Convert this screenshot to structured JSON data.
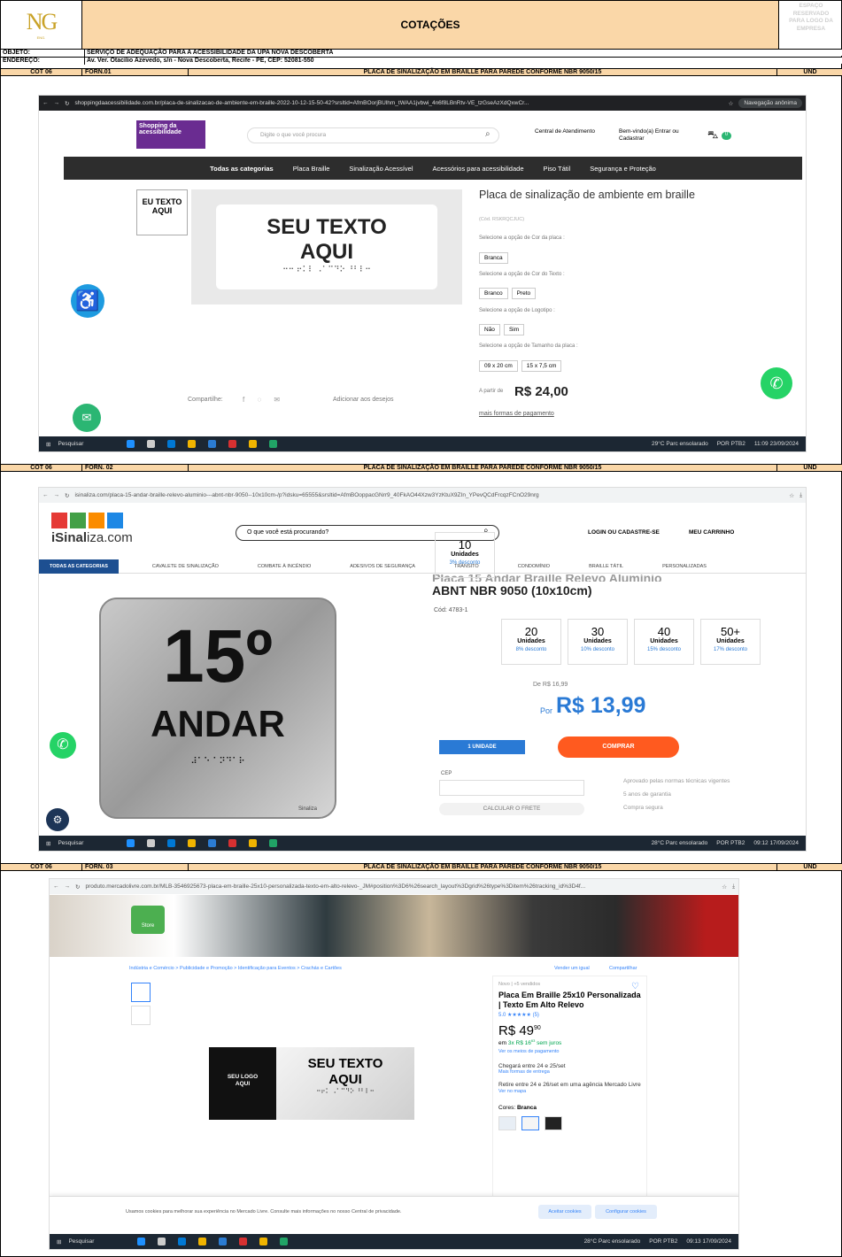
{
  "header": {
    "logo_text": "NG",
    "logo_sub": "ENG.",
    "title": "COTAÇÕES",
    "reserved": [
      "ESPAÇO",
      "RESERVADO",
      "PARA LOGO DA",
      "EMPRESA"
    ]
  },
  "info": {
    "objeto_label": "OBJETO:",
    "objeto": "SERVIÇO DE ADEQUAÇÃO PARA A ACESSIBILIDADE DA UPA NOVA DESCOBERTA",
    "endereco_label": "ENDEREÇO:",
    "endereco": "Av. Ver. Otacílio Azevedo, s/n - Nova Descoberta, Recife - PE, CEP: 52081-550"
  },
  "offers": [
    {
      "cot": "COT 06",
      "forn": "FORN.01",
      "desc": "PLACA DE SINALIZAÇÃO EM BRAILLE PARA PAREDE CONFORME NBR 9050/15",
      "und": "UND"
    },
    {
      "cot": "COT 06",
      "forn": "FORN. 02",
      "desc": "PLACA DE SINALIZAÇÃO EM BRAILLE PARA PAREDE CONFORME NBR 9050/15",
      "und": "UND"
    },
    {
      "cot": "COT 06",
      "forn": "FORN. 03",
      "desc": "PLACA DE SINALIZAÇÃO EM BRAILLE PARA PAREDE CONFORME NBR 9050/15",
      "und": "UND"
    }
  ],
  "shot1": {
    "url": "shoppingdaacessibilidade.com.br/placa-de-sinalizacao-de-ambiente-em-braille-2022-10-12-15-50-42?srsltid=AfmBOorjBUlhm_tWAA1jvbwi_4n6f8LBnRtv-VE_tzGseAzXdQxwCr...",
    "incognito": "Navegação anônima",
    "brand": "Shopping da acessibilidade",
    "search_placeholder": "Digite o que você procura",
    "central": "Central de Atendimento",
    "welcome": "Bem-vindo(a) Entrar ou Cadastrar",
    "cart_count": "0",
    "nav": [
      "Todas as categorias",
      "Placa Braille",
      "Sinalização Acessível",
      "Acessórios para acessibilidade",
      "Piso Tátil",
      "Segurança e Proteção"
    ],
    "thumb_text": "EU TEXTO AQUI",
    "image_text": [
      "SEU TEXTO",
      "AQUI"
    ],
    "braille": "⠒⠒ ⠖⠅⠇ ⠠⠁⠉⠙⠕ ⠘⠃⠇⠒",
    "title": "Placa de sinalização de ambiente em braille",
    "code": "(Cód. RSKRQCJUC)",
    "opt_cor_label": "Selecione a opção de Cor da placa :",
    "opt_cor": [
      "Branca"
    ],
    "opt_texto_label": "Selecione a opção de Cor do Texto :",
    "opt_texto": [
      "Branco",
      "Preto"
    ],
    "opt_logo_label": "Selecione a opção de Logotipo :",
    "opt_logo": [
      "Não",
      "Sim"
    ],
    "opt_tam_label": "Selecione a opção de Tamanho da placa :",
    "opt_tam": [
      "09 x 20 cm",
      "15 x 7,5 cm"
    ],
    "price_prefix": "A partir de",
    "price": "R$ 24,00",
    "payment": "mais formas de pagamento",
    "share": "Compartilhe:",
    "wishlist": "Adicionar aos desejos",
    "tb_search": "Pesquisar",
    "weather": "29°C Parc ensolarado",
    "lang": "POR PTB2",
    "clock": "11:09 23/09/2024"
  },
  "shot2": {
    "url": "isinaliza.com/placa-15-andar-braille-relevo-aluminio---abnt-nbr-9050--10x10cm-/p?idsku=65555&srsltid=AfmBOoppacGNrr9_40FkAO44Xzw3YzKtuX9ZIn_YPevQCdFrcqzFCnO29nrg",
    "brand_a": "iSinal",
    "brand_b": "iza.com",
    "search_placeholder": "O que você está procurando?",
    "login": "LOGIN OU CADASTRE-SE",
    "cart": "MEU CARRINHO",
    "nav": [
      "TODAS AS CATEGORIAS",
      "CAVALETE DE SINALIZAÇÃO",
      "COMBATE À INCÊNDIO",
      "ADESIVOS DE SEGURANÇA",
      "TRÂNSITO",
      "CONDOMÍNIO",
      "BRAILLE TÁTIL",
      "PERSONALIZADAS"
    ],
    "title_partial": "Placa 15 Andar Braille Relevo Alumínio",
    "title": "ABNT NBR 9050 (10x10cm)",
    "code": "Cód: 4783-1",
    "sign_num": "15º",
    "sign_word": "ANDAR",
    "sign_brand": "Sinaliza",
    "tiers": [
      {
        "q": "10",
        "u": "Unidades",
        "d": "3% desconto"
      },
      {
        "q": "20",
        "u": "Unidades",
        "d": "8% desconto"
      },
      {
        "q": "30",
        "u": "Unidades",
        "d": "10% desconto"
      },
      {
        "q": "40",
        "u": "Unidades",
        "d": "15% desconto"
      },
      {
        "q": "50+",
        "u": "Unidades",
        "d": "17% desconto"
      }
    ],
    "old_price": "De R$ 16,99",
    "price_prefix": "Por",
    "price": "R$ 13,99",
    "qty": "1 UNIDADE",
    "buy": "COMPRAR",
    "cep_label": "CEP",
    "frete": "CALCULAR O FRETE",
    "badges": [
      "Aprovado pelas normas técnicas vigentes",
      "5 anos de garantia",
      "Compra segura"
    ],
    "tb_search": "Pesquisar",
    "weather": "28°C Parc ensolarado",
    "lang": "POR PTB2",
    "clock": "09:12 17/09/2024"
  },
  "shot3": {
    "url": "produto.mercadolivre.com.br/MLB-3546925673-placa-em-braille-25x10-personalizada-texto-em-alto-relevo-_JM#position%3D6%26search_layout%3Dgrid%26type%3Ditem%26tracking_id%3D4f...",
    "breadcrumb": "Indústria e Comércio > Publicidade e Promoção > Identificação para Eventos > Crachás e Cartões",
    "sell": "Vender um igual",
    "share": "Compartilhar",
    "store_badge": "Store",
    "condition": "Novo | +5 vendidos",
    "title": "Placa Em Braille 25x10 Personalizada | Texto Em Alto Relevo",
    "rating": "5.0 ★★★★★ (5)",
    "price_int": "R$ 49",
    "price_cents": "90",
    "install_a": "em ",
    "install_b": "3x R$ 16",
    "install_cents": "63",
    "install_c": " sem juros",
    "pay_link": "Ver os meios de pagamento",
    "delivery": "Chegará entre 24 e 25/set",
    "delivery_link": "Mais formas de entrega",
    "pickup": "Retire entre 24 e 26/set em uma agência Mercado Livre",
    "pickup_link": "Ver no mapa",
    "colors_label": "Cores: ",
    "color": "Branca",
    "logo_text": [
      "SEU LOGO",
      "AQUI"
    ],
    "image_text": [
      "SEU TEXTO",
      "AQUI"
    ],
    "braille": "⠒⠖⠅ ⠠⠁⠉⠙⠕ ⠘⠃⠇⠒",
    "cookie": "Usamos cookies para melhorar sua experiência no Mercado Livre. Consulte mais informações no nosso Central de privacidade.",
    "accept": "Aceitar cookies",
    "configure": "Configurar cookies",
    "tb_search": "Pesquisar",
    "weather": "28°C Parc ensolarado",
    "lang": "POR PTB2",
    "clock": "09:13 17/09/2024"
  },
  "colors": {
    "header_fill": "#fad7a8",
    "nav_dark": "#2d2d2d",
    "isinaliza_blue": "#1d4f91",
    "buy_orange": "#ff5a1f",
    "price_blue": "#2a7ad5",
    "ml_green": "#4caf50"
  }
}
